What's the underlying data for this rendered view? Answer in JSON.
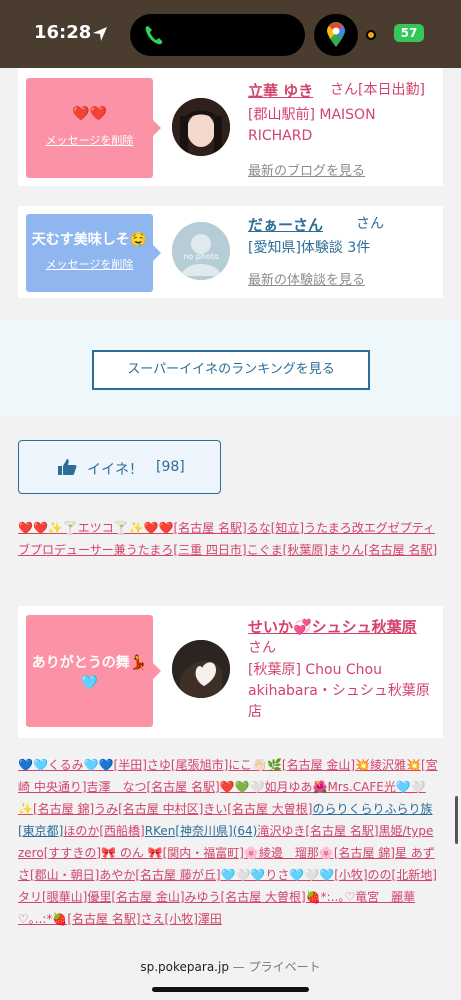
{
  "status": {
    "time": "16:28",
    "battery": "57"
  },
  "cards": [
    {
      "message": "❤️❤️",
      "delete_label": "メッセージを削除",
      "name": "立華 ゆき",
      "suffix": "さん[本日出勤]",
      "info": "[郡山駅前] MAISON RICHARD",
      "more": "最新のブログを見る"
    },
    {
      "message": "天むす美味しそ🤤",
      "delete_label": "メッセージを削除",
      "name": "だぁーさん",
      "suffix": "さん",
      "info": "[愛知県]体験談 3件",
      "more": "最新の体験談を見る",
      "avatar_text": "no photo"
    },
    {
      "message": "ありがとうの舞💃🩵",
      "name": "せいか💞シュシュ秋葉原",
      "suffix": "さん",
      "info": "[秋葉原] Chou Chou akihabara・シュシュ秋葉原店"
    }
  ],
  "ranking_button": "スーパーイイネのランキングを見る",
  "iine": {
    "label": "イイネ！",
    "count": "[98]"
  },
  "likers_1": "❤️❤️✨🍸エツコ🍸✨❤️❤️[名古屋 名駅]るな[知立]うたまろ改エグゼプティブプロデューサー兼うたまろ[三重 四日市]こぐま[秋葉原]まりん[名古屋 名駅]",
  "likers_2a": "💙🩵くるみ🩵💙[半田]さゆ[尾張旭市]にこ👋🏻🌿[名古屋 金山]💥綾沢雅💥[宮崎 中央通り]吉澤　なつ[名古屋 名駅]❤️💚🤍如月ゆあ🌺Mrs.CAFE光🩵🤍✨[名古屋 錦]うみ[名古屋 中村区]きい[名古屋 大曽根]",
  "likers_2b": "のらりくらりふらり族[東京都]",
  "likers_2c": "ほのか[西船橋]",
  "likers_2d": "RKen[神奈川県](64)",
  "likers_2e": "滝沢ゆき[名古屋 名駅]黒姫/type zero[すすきの]🎀 のん 🎀[関内・福富町]🌸綾邊　瑠那🌸[名古屋 錦]星 あずさ[郡山・朝日]あやか[名古屋 藤が丘]🩵🤍🩵りさ🩵🤍🩵[小牧]のの[北新地]タリ[覗華山]優里[名古屋 金山]みゆう[名古屋 大曽根]🍓*:..｡♡竜宮　麗華♡｡..:*🍓[名古屋 名駅]さえ[小牧]澤田",
  "browser": {
    "domain": "sp.pokepara.jp",
    "mode": "— プライベート"
  }
}
